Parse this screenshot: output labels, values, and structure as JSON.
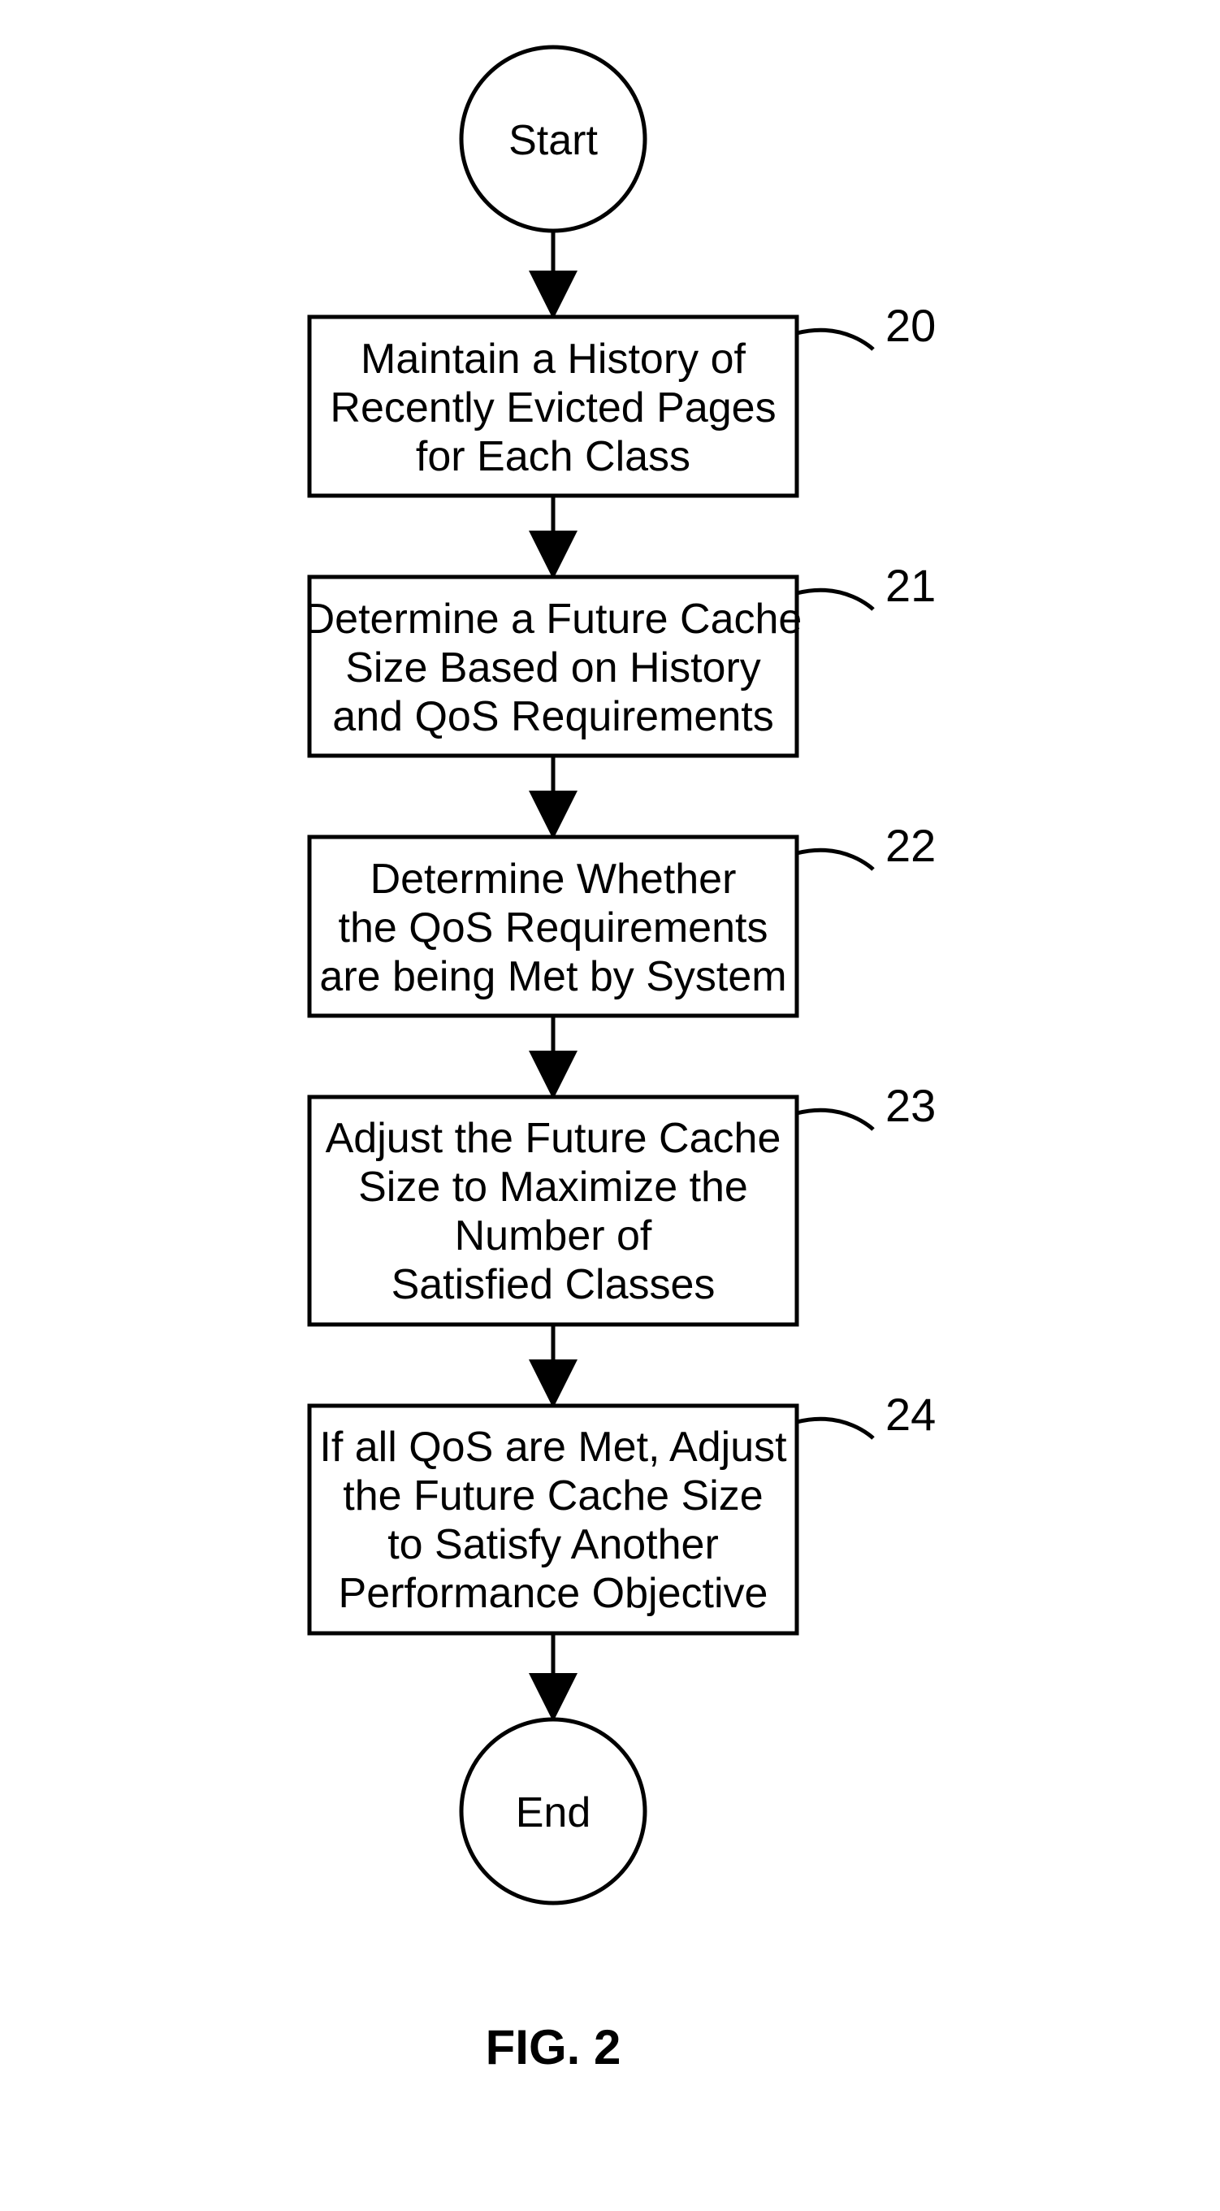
{
  "chart_data": {
    "type": "flowchart",
    "title": "FIG. 2",
    "nodes": [
      {
        "id": "start",
        "shape": "circle",
        "text": "Start"
      },
      {
        "id": "20",
        "shape": "rect",
        "text": "Maintain a History of Recently Evicted Pages for Each Class",
        "label": "20"
      },
      {
        "id": "21",
        "shape": "rect",
        "text": "Determine a Future Cache Size Based on History and QoS Requirements",
        "label": "21"
      },
      {
        "id": "22",
        "shape": "rect",
        "text": "Determine Whether the QoS Requirements are being Met by System",
        "label": "22"
      },
      {
        "id": "23",
        "shape": "rect",
        "text": "Adjust the Future Cache Size to Maximize the Number of Satisfied Classes",
        "label": "23"
      },
      {
        "id": "24",
        "shape": "rect",
        "text": "If all QoS are Met, Adjust the Future Cache Size to Satisfy Another Performance Objective",
        "label": "24"
      },
      {
        "id": "end",
        "shape": "circle",
        "text": "End"
      }
    ],
    "edges": [
      [
        "start",
        "20"
      ],
      [
        "20",
        "21"
      ],
      [
        "21",
        "22"
      ],
      [
        "22",
        "23"
      ],
      [
        "23",
        "24"
      ],
      [
        "24",
        "end"
      ]
    ]
  },
  "terminals": {
    "start": "Start",
    "end": "End"
  },
  "steps": {
    "s20": {
      "label": "20",
      "l1": "Maintain a History of",
      "l2": "Recently Evicted Pages",
      "l3": "for Each Class"
    },
    "s21": {
      "label": "21",
      "l1": "Determine a Future Cache",
      "l2": "Size Based on History",
      "l3": "and QoS Requirements"
    },
    "s22": {
      "label": "22",
      "l1": "Determine Whether",
      "l2": "the QoS Requirements",
      "l3": "are being Met by System"
    },
    "s23": {
      "label": "23",
      "l1": "Adjust the Future Cache",
      "l2": "Size to Maximize the",
      "l3": "Number of",
      "l4": "Satisfied Classes"
    },
    "s24": {
      "label": "24",
      "l1": "If all QoS are Met, Adjust",
      "l2": "the Future Cache Size",
      "l3": "to Satisfy Another",
      "l4": "Performance Objective"
    }
  },
  "figure_caption": "FIG. 2"
}
